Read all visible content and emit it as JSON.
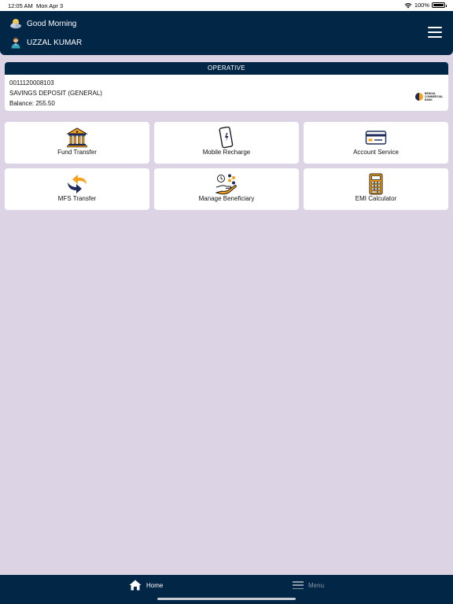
{
  "status_bar": {
    "time": "12:05 AM",
    "date": "Mon Apr 3",
    "battery": "100%"
  },
  "header": {
    "greeting": "Good Morning",
    "user_name": "UZZAL KUMAR"
  },
  "account": {
    "status": "OPERATIVE",
    "number": "0011120008103",
    "type": "SAVINGS DEPOSIT (GENERAL)",
    "balance": "Balance: 255.50",
    "bank_name": "BENGAL COMMERCIAL BANK"
  },
  "services": [
    {
      "label": "Fund Transfer",
      "icon": "bank-icon"
    },
    {
      "label": "Mobile Recharge",
      "icon": "mobile-phone-icon"
    },
    {
      "label": "Account Service",
      "icon": "card-icon"
    },
    {
      "label": "MFS Transfer",
      "icon": "transfer-arrows-icon"
    },
    {
      "label": "Manage Beneficiary",
      "icon": "beneficiary-icon"
    },
    {
      "label": "EMI Calculator",
      "icon": "calculator-icon"
    }
  ],
  "bottom_nav": {
    "home": "Home",
    "menu": "Menu"
  },
  "colors": {
    "primary": "#022646",
    "background": "#dcd4e4",
    "accent": "#f6a21a"
  }
}
